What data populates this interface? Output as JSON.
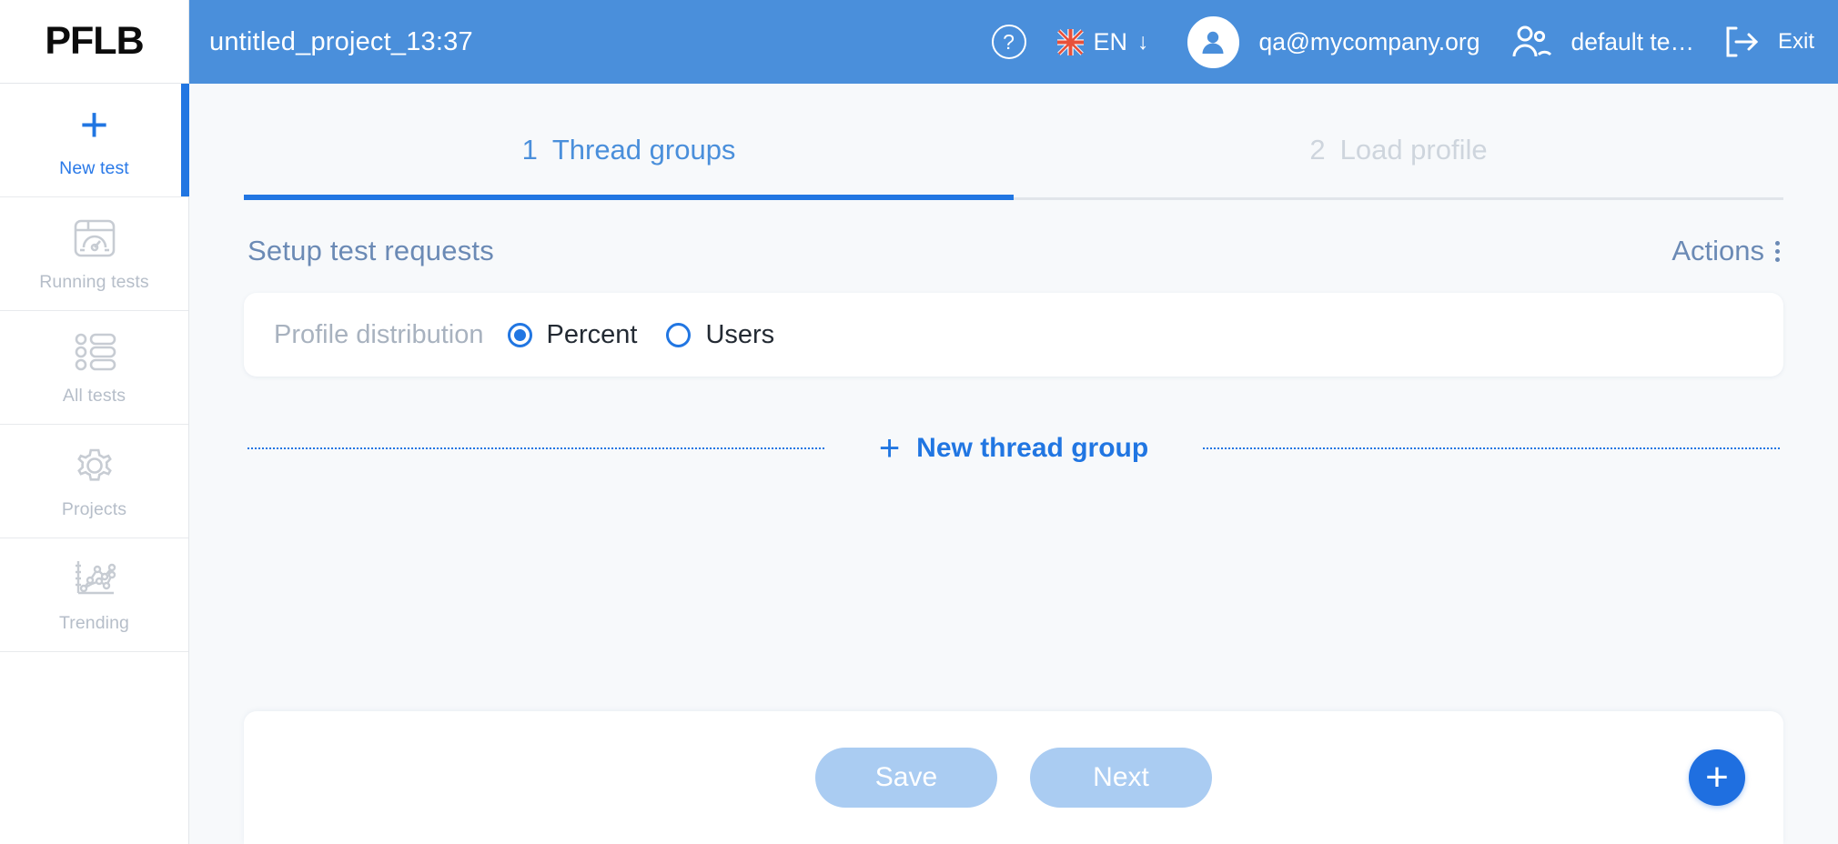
{
  "brand": {
    "logo": "PFLB"
  },
  "topbar": {
    "project_title": "untitled_project_13:37",
    "help_icon": "question-mark-circle-icon",
    "language": {
      "code": "EN",
      "caret": "↓",
      "flag": "uk-flag-icon"
    },
    "user_email": "qa@mycompany.org",
    "team_icon": "people-group-icon",
    "team_name": "default te…",
    "exit_icon": "logout-arrow-icon",
    "exit_label": "Exit",
    "bg_color": "#4a8fdb"
  },
  "sidebar": {
    "items": [
      {
        "label": "New test",
        "icon": "plus-icon",
        "active": true
      },
      {
        "label": "Running tests",
        "icon": "gauge-window-icon",
        "active": false
      },
      {
        "label": "All tests",
        "icon": "bulleted-list-icon",
        "active": false
      },
      {
        "label": "Projects",
        "icon": "gear-icon",
        "active": false
      },
      {
        "label": "Trending",
        "icon": "line-chart-icon",
        "active": false
      }
    ],
    "active_color": "#2176e2",
    "inactive_color": "#b6bec9"
  },
  "tabs": [
    {
      "num": "1",
      "label": "Thread groups",
      "active": true
    },
    {
      "num": "2",
      "label": "Load profile",
      "active": false
    }
  ],
  "section": {
    "title": "Setup test requests",
    "actions_label": "Actions",
    "actions_icon": "vertical-dots-icon"
  },
  "profile_distribution": {
    "label": "Profile distribution",
    "options": [
      {
        "label": "Percent",
        "selected": true
      },
      {
        "label": "Users",
        "selected": false
      }
    ]
  },
  "thread_group": {
    "new_button_label": "New thread group",
    "new_button_plus": "+"
  },
  "footer": {
    "save_label": "Save",
    "next_label": "Next",
    "fab_icon": "plus-icon",
    "fab_color": "#1f6fe0",
    "disabled_button_color": "#aaccf2"
  }
}
